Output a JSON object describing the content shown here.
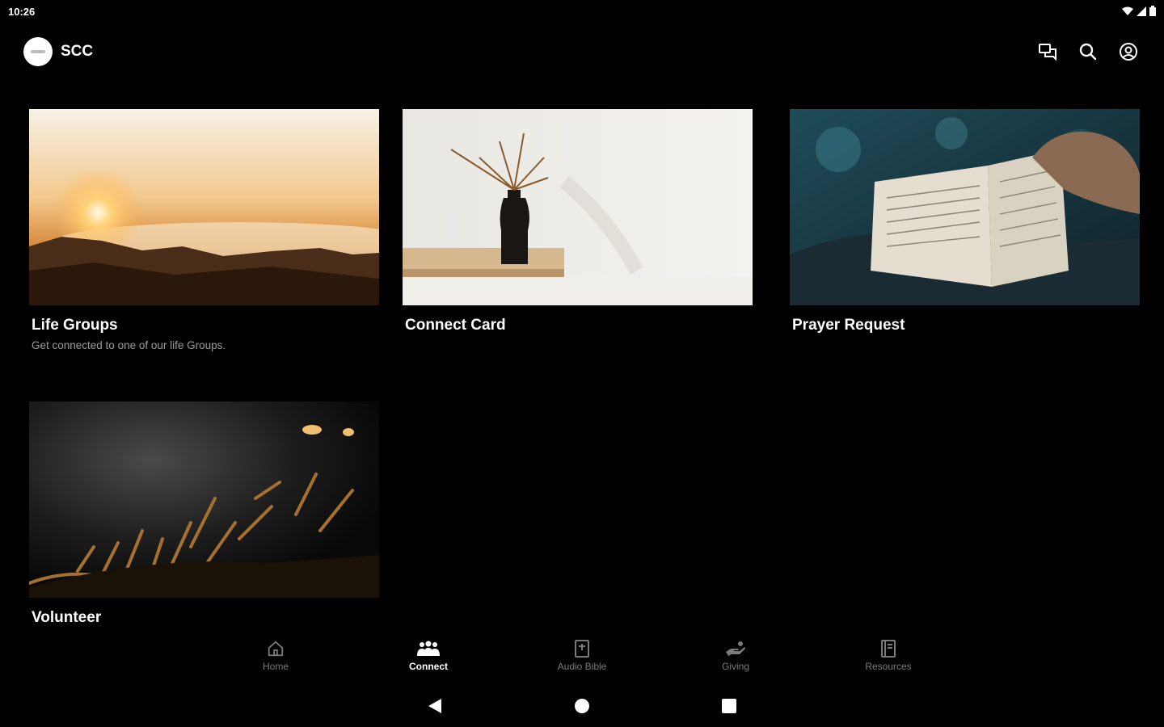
{
  "status": {
    "time": "10:26",
    "icons": [
      "wifi-icon",
      "signal-icon",
      "battery-icon"
    ]
  },
  "appbar": {
    "title": "SCC",
    "actions": [
      "chat-icon",
      "search-icon",
      "account-icon"
    ]
  },
  "cards": [
    {
      "title": "Life Groups",
      "subtitle": "Get connected to one of our life Groups."
    },
    {
      "title": "Connect Card",
      "subtitle": ""
    },
    {
      "title": "Prayer Request",
      "subtitle": ""
    },
    {
      "title": "Volunteer",
      "subtitle": ""
    }
  ],
  "bottom_nav": {
    "active": "Connect",
    "items": [
      {
        "label": "Home",
        "icon": "home-icon"
      },
      {
        "label": "Connect",
        "icon": "people-icon"
      },
      {
        "label": "Audio Bible",
        "icon": "bible-icon"
      },
      {
        "label": "Giving",
        "icon": "giving-hand-icon"
      },
      {
        "label": "Resources",
        "icon": "book-icon"
      }
    ]
  },
  "colors": {
    "background": "#000000",
    "text": "#ffffff",
    "muted_text": "#9a9a9a",
    "inactive_nav": "#7a7a7a"
  }
}
